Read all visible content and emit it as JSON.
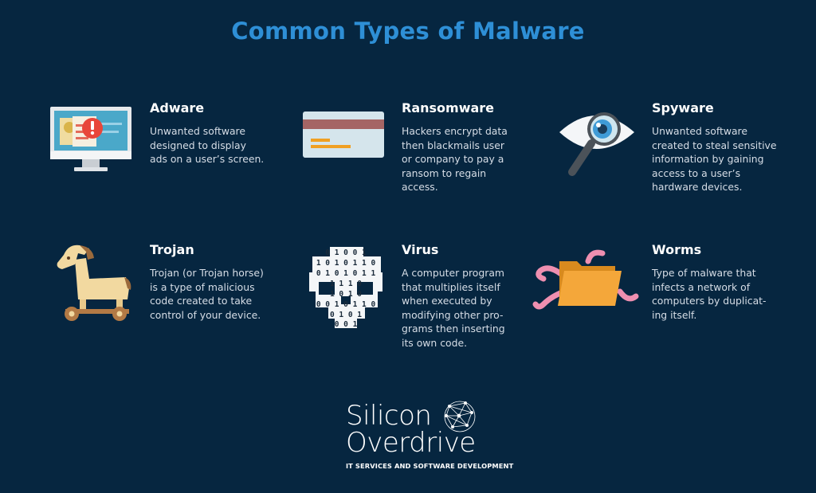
{
  "title": "Common Types of Malware",
  "items": [
    {
      "title": "Adware",
      "description": "Unwanted software\ndesigned to display\nads on a user’s screen.",
      "icon": "monitor-alert-icon"
    },
    {
      "title": "Ransomware",
      "description": "Hackers encrypt data\nthen blackmails user\nor company to pay a\nransom to regain\naccess.",
      "icon": "credit-card-icon"
    },
    {
      "title": "Spyware",
      "description": "Unwanted software\ncreated to steal sensitive\ninformation by gaining\naccess to a user’s\nhardware devices.",
      "icon": "eye-magnifier-icon"
    },
    {
      "title": "Trojan",
      "description": "Trojan (or Trojan horse)\nis a type of malicious\ncode created to take\ncontrol of your device.",
      "icon": "trojan-horse-icon"
    },
    {
      "title": "Virus",
      "description": "A computer program\nthat multiplies itself\nwhen executed by\nmodifying other pro-\ngrams then inserting\nits own code.",
      "icon": "binary-skull-icon"
    },
    {
      "title": "Worms",
      "description": "Type of malware that\ninfects a network of\ncomputers by duplicat-\ning itself.",
      "icon": "folder-worms-icon"
    }
  ],
  "binary_rows": [
    "0 1 0 0 1",
    "1 0 1 0 1 1 0",
    "0 1 0 1 0 1 1",
    "1 1 1 0",
    "1 0 1 0",
    "0 0 1 0 1 1 0",
    "0 1 0 1",
    "0 0 1"
  ],
  "logo": {
    "line1": "Silicon",
    "line2": "Overdrive",
    "tagline": "IT SERVICES AND SOFTWARE DEVELOPMENT"
  },
  "colors": {
    "background": "#062640",
    "title": "#2e8fd6",
    "text": "#d6dde6"
  }
}
